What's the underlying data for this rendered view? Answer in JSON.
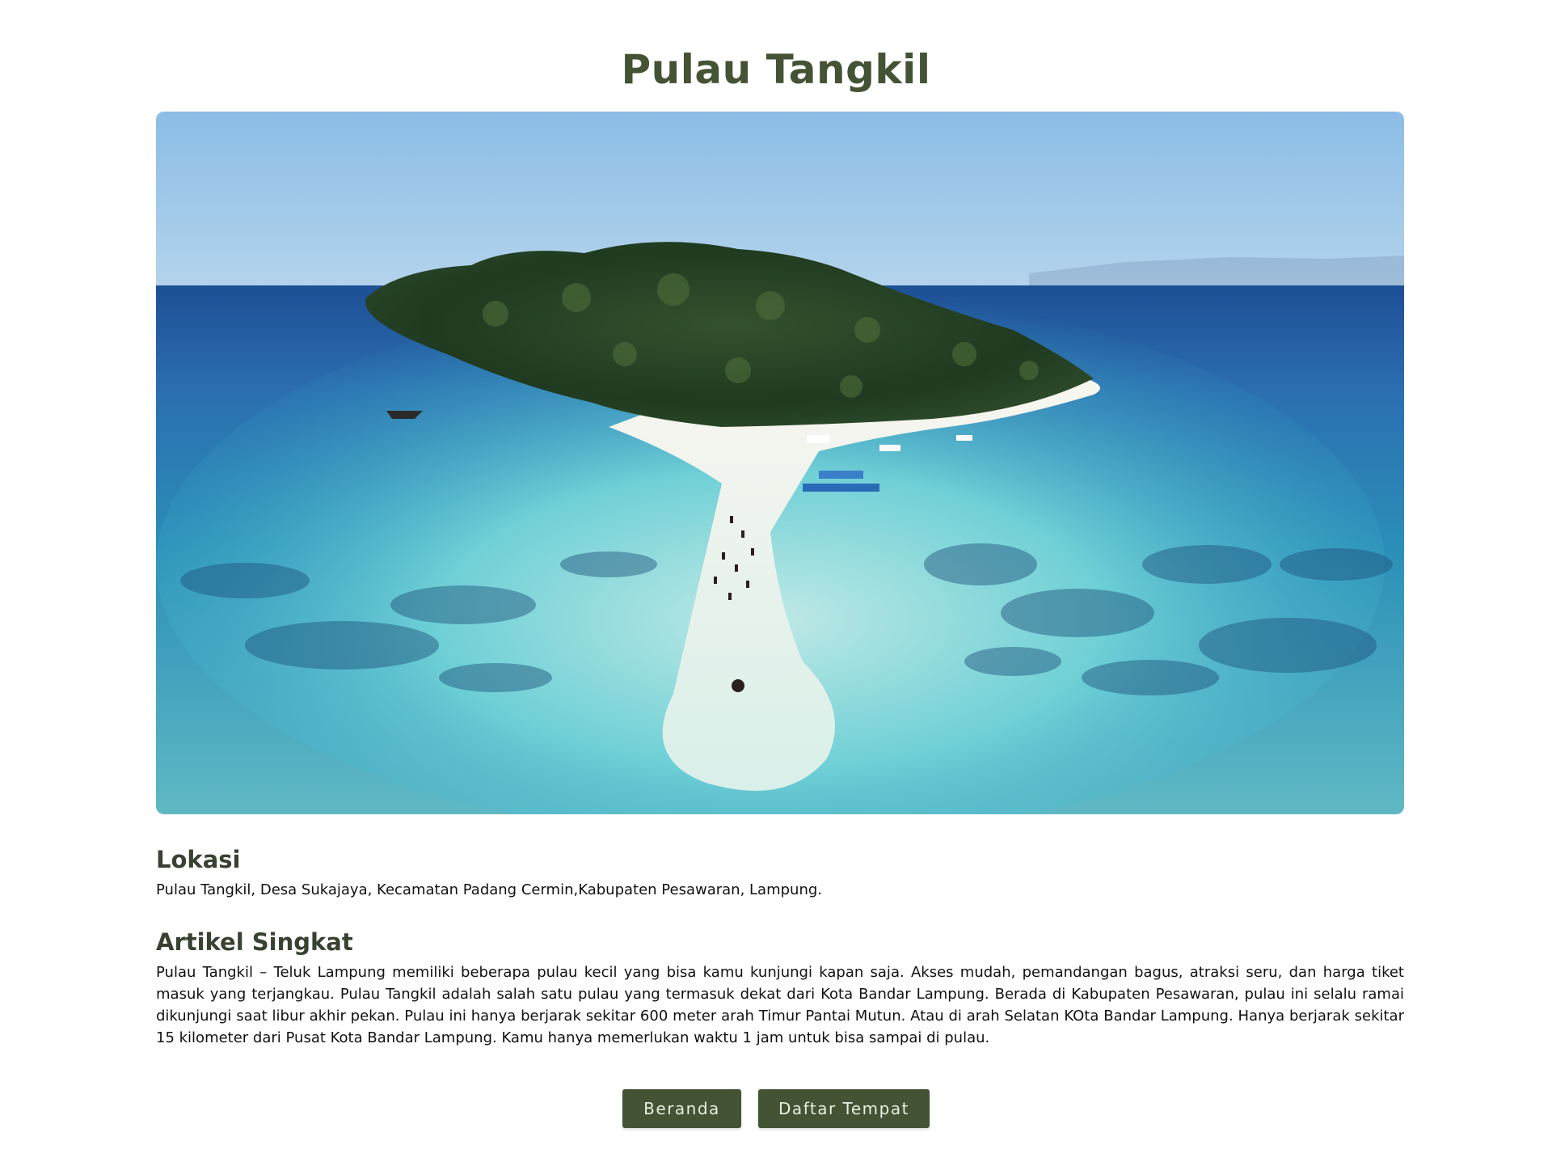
{
  "page": {
    "title": "Pulau Tangkil"
  },
  "hero_image": {
    "alt": "Aerial view of Pulau Tangkil island with a white sandbar and turquoise water"
  },
  "location": {
    "heading": "Lokasi",
    "text": "Pulau Tangkil, Desa Sukajaya, Kecamatan Padang Cermin,Kabupaten Pesawaran, Lampung."
  },
  "article": {
    "heading": "Artikel Singkat",
    "text": "Pulau Tangkil – Teluk Lampung memiliki beberapa pulau kecil yang bisa kamu kunjungi kapan saja. Akses mudah, pemandangan bagus, atraksi seru, dan harga tiket masuk yang terjangkau. Pulau Tangkil adalah salah satu pulau yang termasuk dekat dari Kota Bandar Lampung. Berada di Kabupaten Pesawaran, pulau ini selalu ramai dikunjungi saat libur akhir pekan. Pulau ini hanya berjarak sekitar 600 meter arah Timur Pantai Mutun. Atau di arah Selatan KOta Bandar Lampung. Hanya berjarak sekitar 15 kilometer dari Pusat Kota Bandar Lampung. Kamu hanya memerlukan waktu 1 jam untuk bisa sampai di pulau."
  },
  "buttons": {
    "home_label": "Beranda",
    "list_label": "Daftar Tempat"
  },
  "colors": {
    "accent": "#435334",
    "heading": "#374230",
    "button_text": "#e8efe0"
  }
}
